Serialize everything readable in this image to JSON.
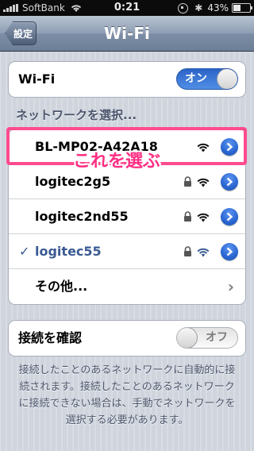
{
  "status_bar": {
    "carrier": "SoftBank",
    "time": "0:21",
    "battery_percent": "43%",
    "battery_level": 0.43
  },
  "nav": {
    "back_label": "設定",
    "title": "Wi-Fi"
  },
  "wifi_toggle": {
    "label": "Wi-Fi",
    "state_label": "オン",
    "on": true
  },
  "networks_section": {
    "header": "ネットワークを選択...",
    "items": [
      {
        "name": "BL-MP02-A42A18",
        "locked": false,
        "selected": false
      },
      {
        "name": "logitec2g5",
        "locked": true,
        "selected": false
      },
      {
        "name": "logitec2nd55",
        "locked": true,
        "selected": false
      },
      {
        "name": "logitec55",
        "locked": true,
        "selected": true
      }
    ],
    "other_label": "その他..."
  },
  "annotation": {
    "text": "これを選ぶ",
    "color": "#ff4b8d"
  },
  "ask_to_join": {
    "label": "接続を確認",
    "state_label": "オフ",
    "on": false
  },
  "footer": "接続したことのあるネットワークに自動的に接続されます。接続したことのあるネットワークに接続できない場合は、手動でネットワークを選択する必要があります。",
  "icons": {
    "wifi": "wifi-icon",
    "lock": "lock-icon",
    "detail": "detail-disclosure-icon",
    "chevron": "chevron-right-icon"
  },
  "colors": {
    "toggle_on": "#3a78dc",
    "selected_text": "#3a5a93",
    "annotation": "#ff4b8d"
  }
}
